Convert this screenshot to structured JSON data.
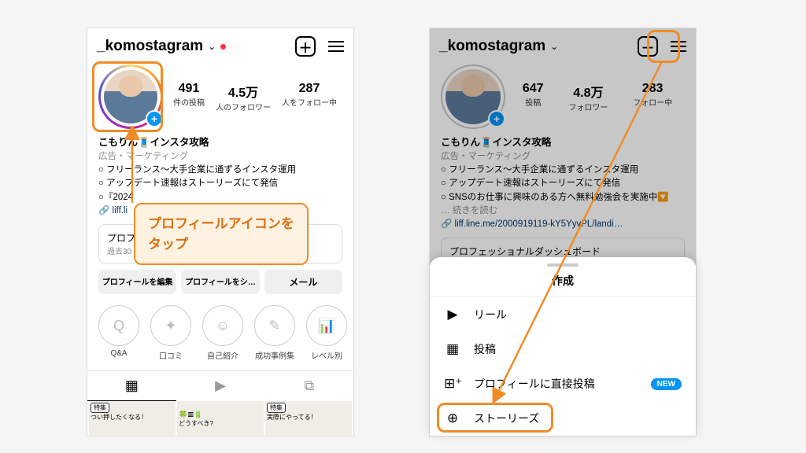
{
  "left": {
    "username": "_komostagram",
    "stats": [
      {
        "n": "491",
        "l": "件の投稿"
      },
      {
        "n": "4.5万",
        "l": "人のフォロワー"
      },
      {
        "n": "287",
        "l": "人をフォロー中"
      }
    ],
    "bio": {
      "name": "こもりん🧵インスタ攻略",
      "cat": "広告・マーケティング",
      "l1": "○ フリーランス〜大手企業に通ずるインスタ運用",
      "l2": "○ アップデート速報はストーリーズにて発信",
      "l3": "○『2024",
      "link": "liff.li"
    },
    "dash": {
      "t": "プロフ",
      "s": "過去30"
    },
    "buttons": {
      "edit": "プロフィールを編集",
      "share": "プロフィールをシ…",
      "mail": "メール"
    },
    "highlights": [
      {
        "label": "Q&A",
        "icon": "Q"
      },
      {
        "label": "口コミ",
        "icon": "✦"
      },
      {
        "label": "自己紹介",
        "icon": "☺"
      },
      {
        "label": "成功事例集",
        "icon": "✎"
      },
      {
        "label": "レベル別",
        "icon": "↗"
      }
    ],
    "grid": {
      "tag1": "特集",
      "c1": "つい押したくなる！",
      "c2": "どうすべき?",
      "tag3": "特集",
      "c3": "実際にやってる！"
    }
  },
  "right": {
    "username": "_komostagram",
    "stats": [
      {
        "n": "647",
        "l": "投稿"
      },
      {
        "n": "4.8万",
        "l": "フォロワー"
      },
      {
        "n": "283",
        "l": "フォロー中"
      }
    ],
    "bio": {
      "name": "こもりん🧵インスタ攻略",
      "cat": "広告・マーケティング",
      "l1": "○ フリーランス〜大手企業に通ずるインスタ運用",
      "l2": "○ アップデート速報はストーリーズにて発信",
      "l3": "○ SNSのお仕事に興味のある方へ無料勉強会を実施中🔽",
      "more": "… 続きを読む",
      "link": "liff.line.me/2000919119-kY5YyvPL/landi…"
    },
    "dash": "プロフェッショナルダッシュボード",
    "sheet": {
      "title": "作成",
      "items": [
        {
          "icon": "reel",
          "label": "リール"
        },
        {
          "icon": "grid",
          "label": "投稿"
        },
        {
          "icon": "gridplus",
          "label": "プロフィールに直接投稿",
          "new": "NEW"
        },
        {
          "icon": "storyplus",
          "label": "ストーリーズ"
        }
      ]
    }
  },
  "callout": {
    "l1": "プロフィールアイコンを",
    "l2": "タップ"
  }
}
